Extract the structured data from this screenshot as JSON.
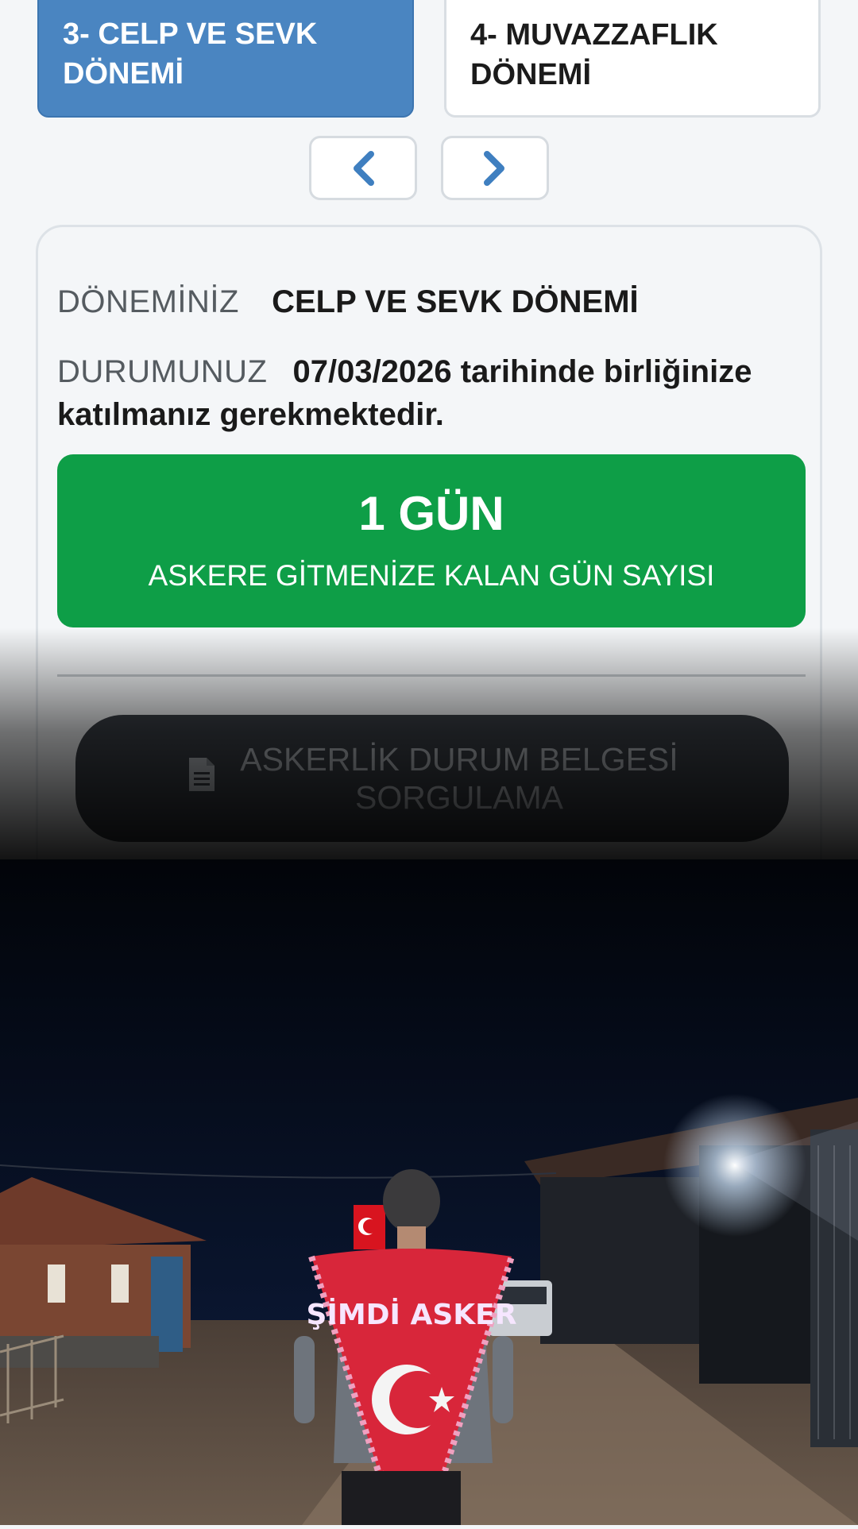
{
  "periods": {
    "active_label": "3- CELP VE SEVK DÖNEMİ",
    "next_label": "4- MUVAZZAFLIK DÖNEMİ"
  },
  "nav": {
    "prev_icon": "chevron-left-icon",
    "next_icon": "chevron-right-icon"
  },
  "status": {
    "period_label": "DÖNEMİNİZ",
    "period_value": "CELP VE SEVK DÖNEMİ",
    "state_label": "DURUMUNUZ",
    "state_value": "07/03/2026 tarihinde birliğinize katılmanız gerekmektedir."
  },
  "counter": {
    "value": "1 GÜN",
    "caption": "ASKERE GİTMENİZE KALAN GÜN SAYISI"
  },
  "document_button": {
    "label_line1": "ASKERLİK DURUM BELGESİ",
    "label_line2": "SORGULAMA",
    "icon": "document-icon"
  },
  "photo": {
    "jacket_text": "ŞİMDİ ASKER"
  },
  "colors": {
    "active_tab": "#4a85c1",
    "counter_green": "#0e9e47",
    "accent_blue": "#3f7fc0"
  }
}
